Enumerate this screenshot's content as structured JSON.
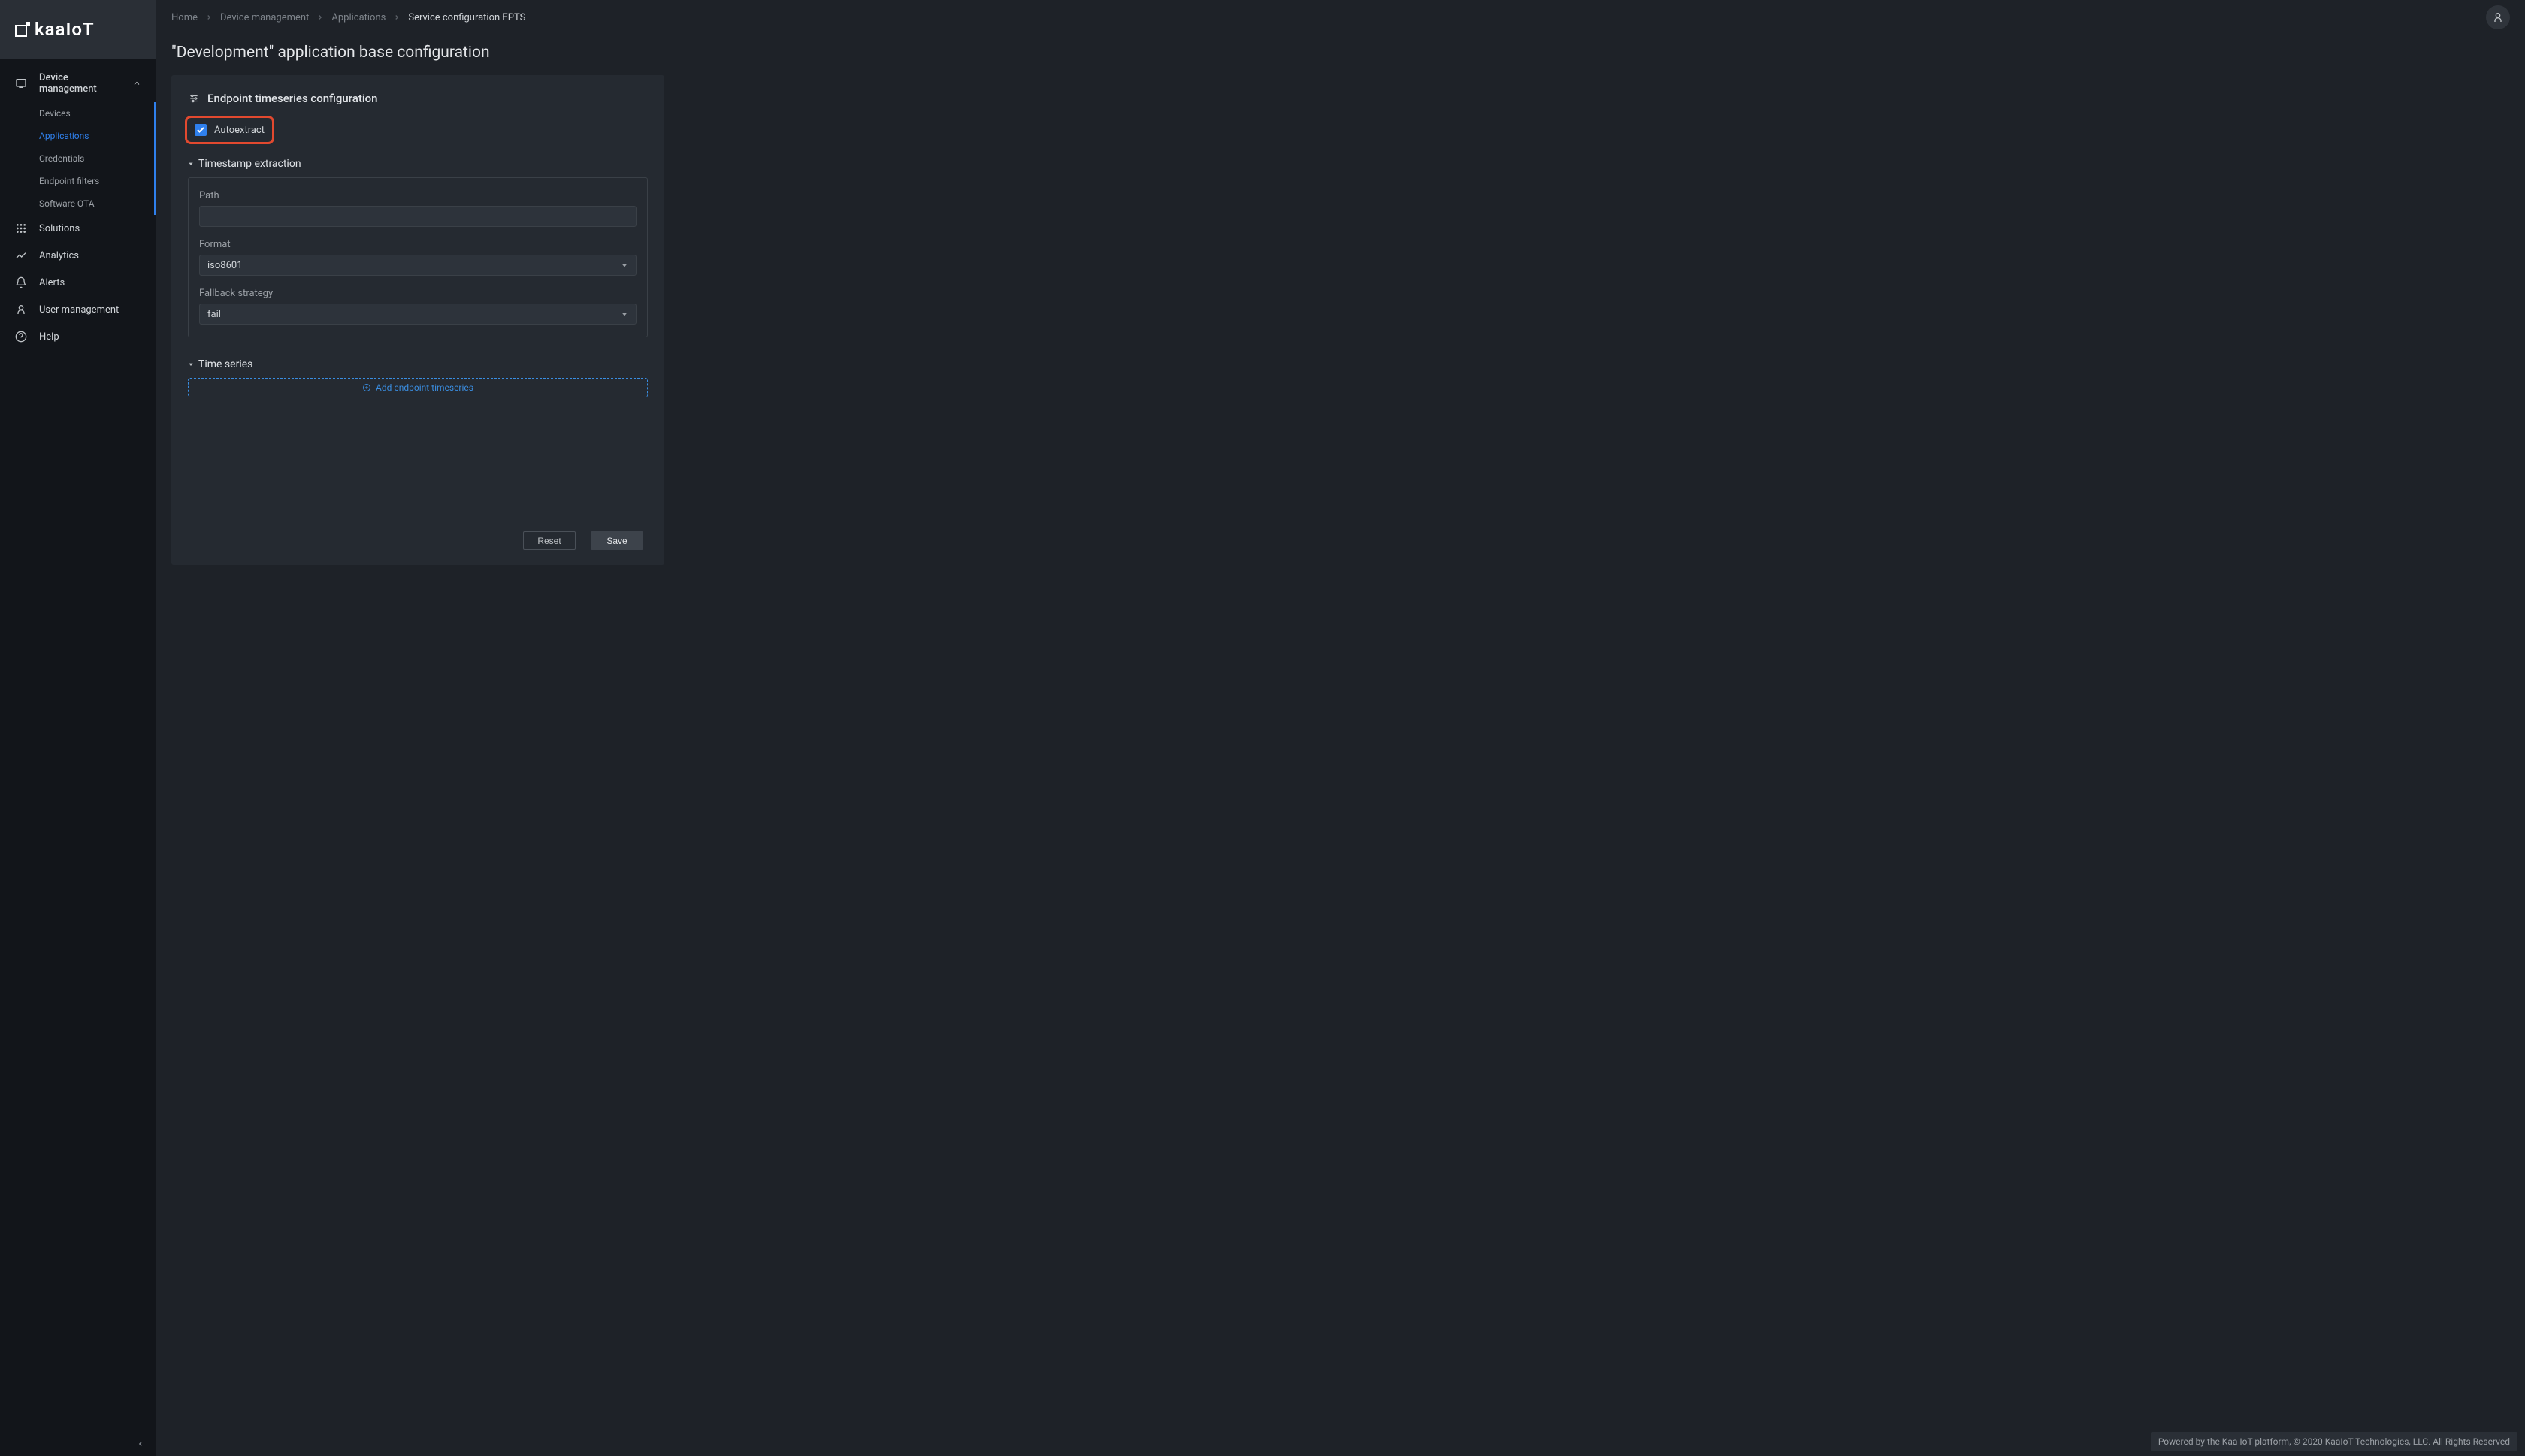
{
  "logo_text": "kaaIoT",
  "breadcrumb": {
    "home": "Home",
    "device_mgmt": "Device management",
    "applications": "Applications",
    "current": "Service configuration EPTS"
  },
  "sidebar": {
    "device_mgmt": "Device management",
    "devices": "Devices",
    "applications": "Applications",
    "credentials": "Credentials",
    "endpoint_filters": "Endpoint filters",
    "software_ota": "Software OTA",
    "solutions": "Solutions",
    "analytics": "Analytics",
    "alerts": "Alerts",
    "user_mgmt": "User management",
    "help": "Help"
  },
  "page": {
    "title": "\"Development\" application base configuration"
  },
  "panel": {
    "header": "Endpoint timeseries configuration",
    "autoextract_label": "Autoextract",
    "autoextract_checked": true,
    "ts_extraction_header": "Timestamp extraction",
    "path_label": "Path",
    "path_value": "",
    "format_label": "Format",
    "format_value": "iso8601",
    "fallback_label": "Fallback strategy",
    "fallback_value": "fail",
    "time_series_header": "Time series",
    "add_ts_label": "Add endpoint timeseries",
    "reset_label": "Reset",
    "save_label": "Save"
  },
  "footer": "Powered by the Kaa IoT platform, © 2020 KaaIoT Technologies, LLC. All Rights Reserved"
}
